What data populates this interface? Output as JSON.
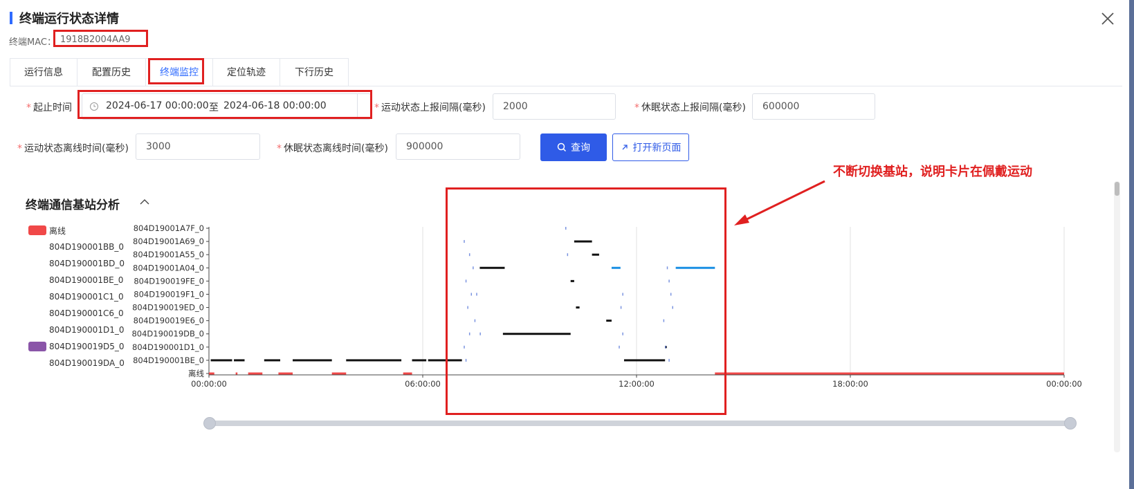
{
  "dialog": {
    "title": "终端运行状态详情",
    "mac_label": "终端MAC：",
    "mac_value": "1918B2004AA9"
  },
  "tabs": [
    {
      "label": "运行信息",
      "active": false
    },
    {
      "label": "配置历史",
      "active": false
    },
    {
      "label": "终端监控",
      "active": true
    },
    {
      "label": "定位轨迹",
      "active": false
    },
    {
      "label": "下行历史",
      "active": false
    }
  ],
  "form": {
    "required_mark": "*",
    "time_range": {
      "label": "起止时间",
      "start": "2024-06-17 00:00:00",
      "separator": "至",
      "end": "2024-06-18 00:00:00"
    },
    "motion_report_interval": {
      "label": "运动状态上报间隔(毫秒)",
      "value": "2000"
    },
    "sleep_report_interval": {
      "label": "休眠状态上报间隔(毫秒)",
      "value": "600000"
    },
    "motion_offline_time": {
      "label": "运动状态离线时间(毫秒)",
      "value": "3000"
    },
    "sleep_offline_time": {
      "label": "休眠状态离线时间(毫秒)",
      "value": "900000"
    },
    "query_button": "查询",
    "open_page_button": "打开新页面"
  },
  "annotation": {
    "text": "不断切换基站，说明卡片在佩戴运动",
    "color": "#e02020"
  },
  "section": {
    "title": "终端通信基站分析"
  },
  "legend": [
    {
      "label": "离线",
      "color": "#f04848"
    },
    {
      "label": "804D190001BB_0",
      "color": ""
    },
    {
      "label": "804D190001BD_0",
      "color": ""
    },
    {
      "label": "804D190001BE_0",
      "color": ""
    },
    {
      "label": "804D190001C1_0",
      "color": ""
    },
    {
      "label": "804D190001C6_0",
      "color": ""
    },
    {
      "label": "804D190001D1_0",
      "color": ""
    },
    {
      "label": "804D190019D5_0",
      "color": "#8a55a8"
    },
    {
      "label": "804D190019DA_0",
      "color": ""
    }
  ],
  "chart_data": {
    "type": "timeline",
    "y_categories": [
      "离线",
      "804D190001BE_0",
      "804D190001D1_0",
      "804D190019DB_0",
      "804D190019E6_0",
      "804D190019ED_0",
      "804D190019F1_0",
      "804D190019FE_0",
      "804D19001A04_0",
      "804D19001A55_0",
      "804D19001A69_0",
      "804D19001A7F_0"
    ],
    "x_ticks": [
      "00:00:00",
      "06:00:00",
      "12:00:00",
      "18:00:00",
      "00:00:00"
    ],
    "x_range_hours": [
      0,
      24
    ],
    "grid": "vertical lines at each x tick",
    "colors": {
      "offline": "#f04848",
      "station": "#111111",
      "highlight": "#1a8fe3"
    },
    "segments": [
      {
        "category": "804D190001BE_0",
        "start": 0.05,
        "end": 0.65,
        "color": "#111111"
      },
      {
        "category": "804D190001BE_0",
        "start": 0.7,
        "end": 1.0,
        "color": "#111111"
      },
      {
        "category": "804D190001BE_0",
        "start": 1.55,
        "end": 2.0,
        "color": "#111111"
      },
      {
        "category": "804D190001BE_0",
        "start": 2.35,
        "end": 3.45,
        "color": "#111111"
      },
      {
        "category": "804D190001BE_0",
        "start": 3.85,
        "end": 5.4,
        "color": "#111111"
      },
      {
        "category": "804D190001BE_0",
        "start": 5.7,
        "end": 6.1,
        "color": "#111111"
      },
      {
        "category": "804D190001BE_0",
        "start": 6.15,
        "end": 7.1,
        "color": "#111111"
      },
      {
        "category": "804D190001BE_0",
        "start": 11.65,
        "end": 12.8,
        "color": "#111111"
      },
      {
        "category": "804D190019DB_0",
        "start": 8.25,
        "end": 10.15,
        "color": "#111111"
      },
      {
        "category": "804D19001A04_0",
        "start": 7.6,
        "end": 8.3,
        "color": "#111111"
      },
      {
        "category": "804D19001A04_0",
        "start": 11.3,
        "end": 11.55,
        "color": "#1a8fe3"
      },
      {
        "category": "804D19001A04_0",
        "start": 13.1,
        "end": 14.2,
        "color": "#1a8fe3"
      },
      {
        "category": "804D19001A55_0",
        "start": 10.75,
        "end": 10.95,
        "color": "#111111"
      },
      {
        "category": "804D19001A69_0",
        "start": 10.25,
        "end": 10.75,
        "color": "#111111"
      },
      {
        "category": "804D190019FE_0",
        "start": 10.15,
        "end": 10.25,
        "color": "#111111"
      },
      {
        "category": "804D190019ED_0",
        "start": 10.3,
        "end": 10.4,
        "color": "#111111"
      },
      {
        "category": "804D190019E6_0",
        "start": 11.15,
        "end": 11.3,
        "color": "#111111"
      },
      {
        "category": "804D190001D1_0",
        "start": 12.8,
        "end": 12.85,
        "color": "#111111"
      },
      {
        "category": "离线",
        "start": 0.0,
        "end": 0.15,
        "color": "#f04848"
      },
      {
        "category": "离线",
        "start": 0.75,
        "end": 0.8,
        "color": "#f04848"
      },
      {
        "category": "离线",
        "start": 1.1,
        "end": 1.5,
        "color": "#f04848"
      },
      {
        "category": "离线",
        "start": 1.95,
        "end": 2.35,
        "color": "#f04848"
      },
      {
        "category": "离线",
        "start": 3.45,
        "end": 3.85,
        "color": "#f04848"
      },
      {
        "category": "离线",
        "start": 5.45,
        "end": 5.7,
        "color": "#f04848"
      },
      {
        "category": "离线",
        "start": 14.2,
        "end": 24.0,
        "color": "#f04848"
      }
    ],
    "scatter_marks": [
      {
        "category": "804D19001A7F_0",
        "t": 10.0
      },
      {
        "category": "804D19001A69_0",
        "t": 7.15
      },
      {
        "category": "804D19001A55_0",
        "t": 10.05
      },
      {
        "category": "804D19001A55_0",
        "t": 7.3
      },
      {
        "category": "804D19001A04_0",
        "t": 7.4
      },
      {
        "category": "804D19001A04_0",
        "t": 12.85
      },
      {
        "category": "804D190019FE_0",
        "t": 7.2
      },
      {
        "category": "804D190019FE_0",
        "t": 12.9
      },
      {
        "category": "804D190019F1_0",
        "t": 7.35
      },
      {
        "category": "804D190019F1_0",
        "t": 7.5
      },
      {
        "category": "804D190019F1_0",
        "t": 11.6
      },
      {
        "category": "804D190019F1_0",
        "t": 12.95
      },
      {
        "category": "804D190019ED_0",
        "t": 7.25
      },
      {
        "category": "804D190019ED_0",
        "t": 11.55
      },
      {
        "category": "804D190019ED_0",
        "t": 13.0
      },
      {
        "category": "804D190019E6_0",
        "t": 7.45
      },
      {
        "category": "804D190019E6_0",
        "t": 12.75
      },
      {
        "category": "804D190019DB_0",
        "t": 7.3
      },
      {
        "category": "804D190019DB_0",
        "t": 7.6
      },
      {
        "category": "804D190019DB_0",
        "t": 11.6
      },
      {
        "category": "804D190001D1_0",
        "t": 7.15
      },
      {
        "category": "804D190001D1_0",
        "t": 11.5
      },
      {
        "category": "804D190001D1_0",
        "t": 12.8
      },
      {
        "category": "804D190001BE_0",
        "t": 7.2
      },
      {
        "category": "804D190001BE_0",
        "t": 12.9
      }
    ]
  }
}
